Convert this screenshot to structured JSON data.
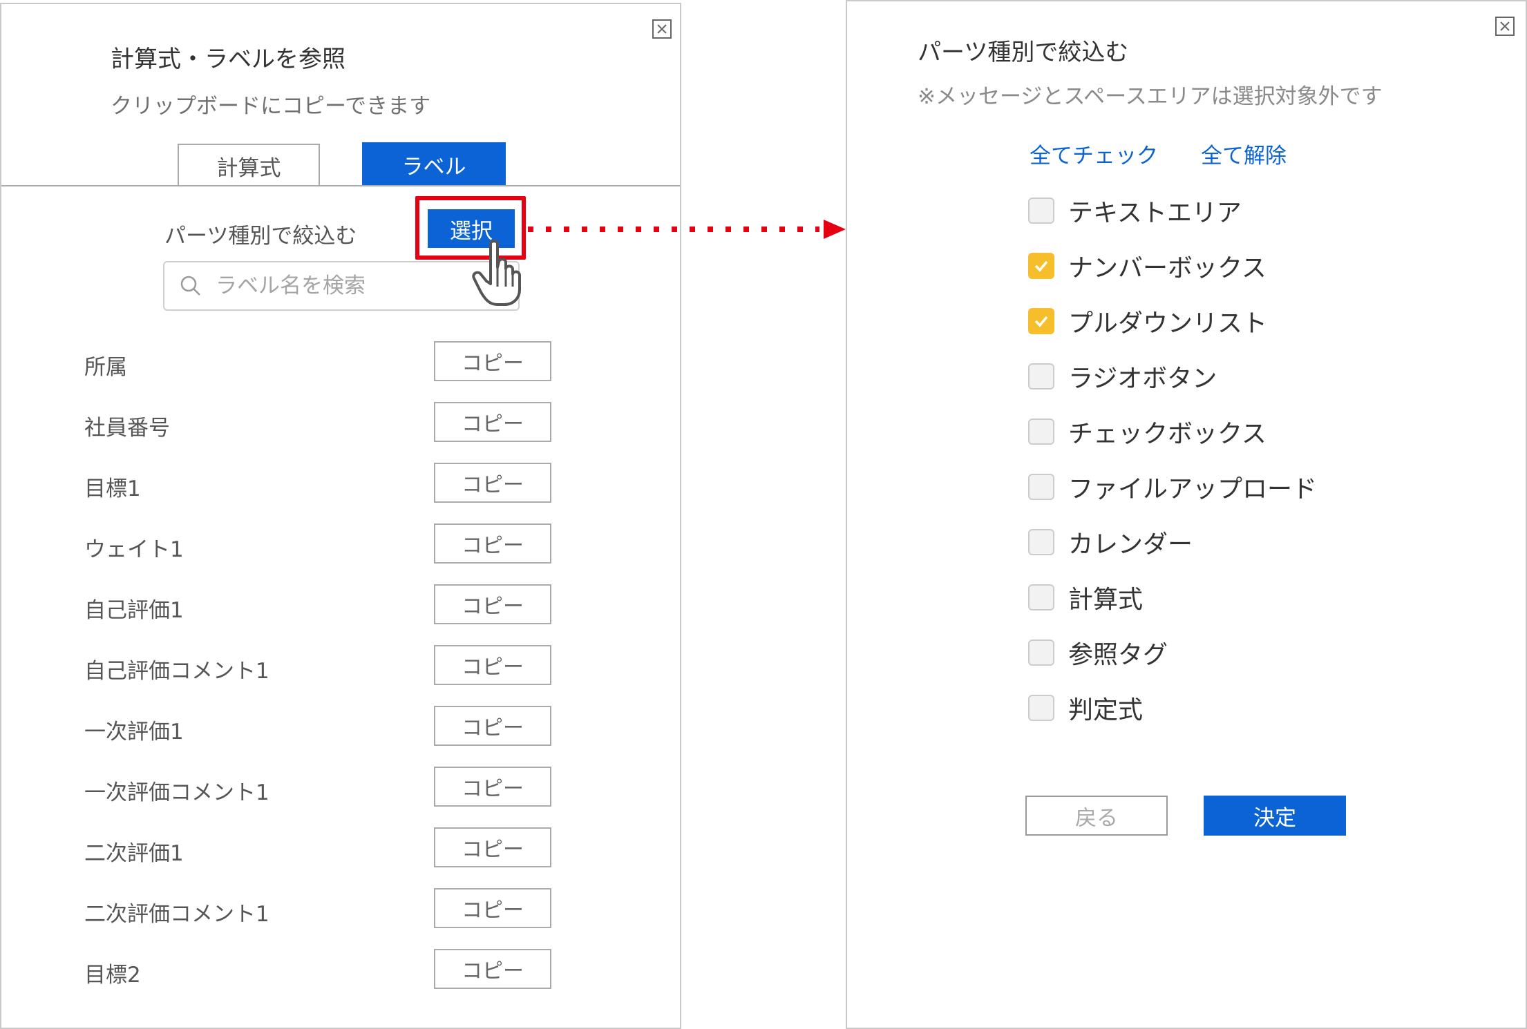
{
  "left_panel": {
    "title": "計算式・ラベルを参照",
    "subtitle": "クリップボードにコピーできます",
    "tabs": [
      {
        "label": "計算式",
        "active": false
      },
      {
        "label": "ラベル",
        "active": true
      }
    ],
    "filter_label": "パーツ種別で絞込む",
    "select_button": "選択",
    "search_placeholder": "ラベル名を検索",
    "copy_label": "コピー",
    "labels": [
      "所属",
      "社員番号",
      "目標1",
      "ウェイト1",
      "自己評価1",
      "自己評価コメント1",
      "一次評価1",
      "一次評価コメント1",
      "二次評価1",
      "二次評価コメント1",
      "目標2"
    ]
  },
  "right_panel": {
    "title": "パーツ種別で絞込む",
    "note": "※メッセージとスペースエリアは選択対象外です",
    "check_all": "全てチェック",
    "uncheck_all": "全て解除",
    "options": [
      {
        "label": "テキストエリア",
        "checked": false
      },
      {
        "label": "ナンバーボックス",
        "checked": true
      },
      {
        "label": "プルダウンリスト",
        "checked": true
      },
      {
        "label": "ラジオボタン",
        "checked": false
      },
      {
        "label": "チェックボックス",
        "checked": false
      },
      {
        "label": "ファイルアップロード",
        "checked": false
      },
      {
        "label": "カレンダー",
        "checked": false
      },
      {
        "label": "計算式",
        "checked": false
      },
      {
        "label": "参照タグ",
        "checked": false
      },
      {
        "label": "判定式",
        "checked": false
      }
    ],
    "back_button": "戻る",
    "ok_button": "決定"
  },
  "colors": {
    "primary": "#0b63d6",
    "highlight": "#e60012",
    "checked": "#f7be2c"
  },
  "icons": [
    "close-icon",
    "search-icon",
    "hand-pointer-icon",
    "check-icon",
    "arrow-right-icon"
  ]
}
